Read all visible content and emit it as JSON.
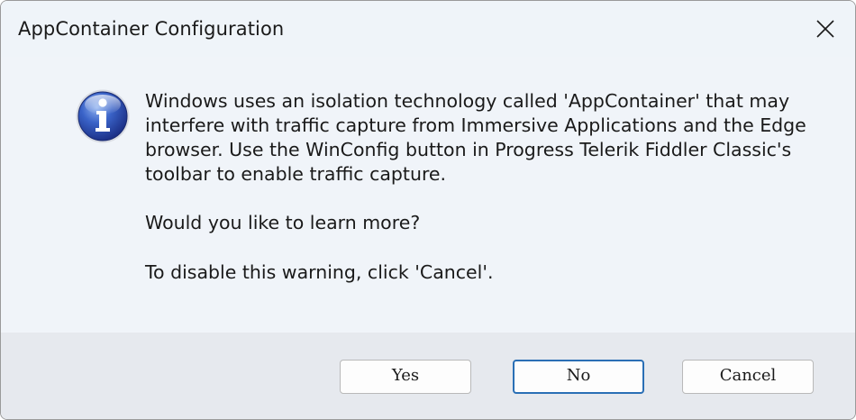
{
  "window": {
    "title": "AppContainer Configuration"
  },
  "icons": {
    "info": "info-icon",
    "close": "close-icon"
  },
  "message": {
    "paragraph1": "Windows uses an isolation technology called 'AppContainer' that may\ninterfere with traffic capture from Immersive Applications and the Edge\nbrowser. Use the WinConfig button in Progress Telerik Fiddler Classic's\ntoolbar to enable traffic capture.",
    "paragraph2": "Would you like to learn more?",
    "paragraph3": "To disable this warning, click 'Cancel'."
  },
  "buttons": {
    "yes": "Yes",
    "no": "No",
    "cancel": "Cancel"
  },
  "colors": {
    "accent": "#2a6fb5",
    "background": "#f0f4f9",
    "footer": "#e6e9ee"
  }
}
